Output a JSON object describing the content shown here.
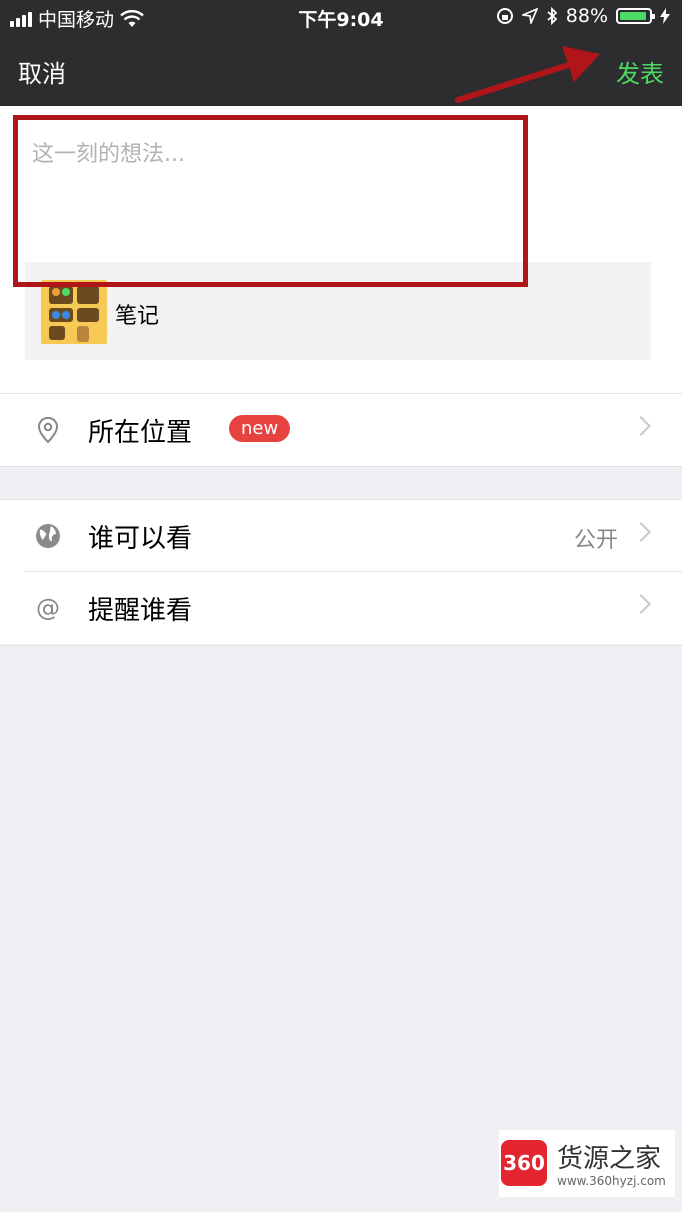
{
  "status_bar": {
    "carrier": "中国移动",
    "time": "下午9:04",
    "battery": "88%",
    "battery_level": 0.88
  },
  "nav": {
    "cancel_label": "取消",
    "publish_label": "发表",
    "publish_color": "#4cd964"
  },
  "compose": {
    "placeholder": "这一刻的想法...",
    "attachment_label": "笔记"
  },
  "rows": {
    "location_label": "所在位置",
    "location_badge": "new",
    "visibility_label": "谁可以看",
    "visibility_value": "公开",
    "remind_label": "提醒谁看"
  },
  "watermark": {
    "logo": "360",
    "title": "货源之家",
    "url": "www.360hyzj.com"
  },
  "colors": {
    "highlight": "#b0151a",
    "badge": "#e64340",
    "bar": "#2d2d30"
  }
}
